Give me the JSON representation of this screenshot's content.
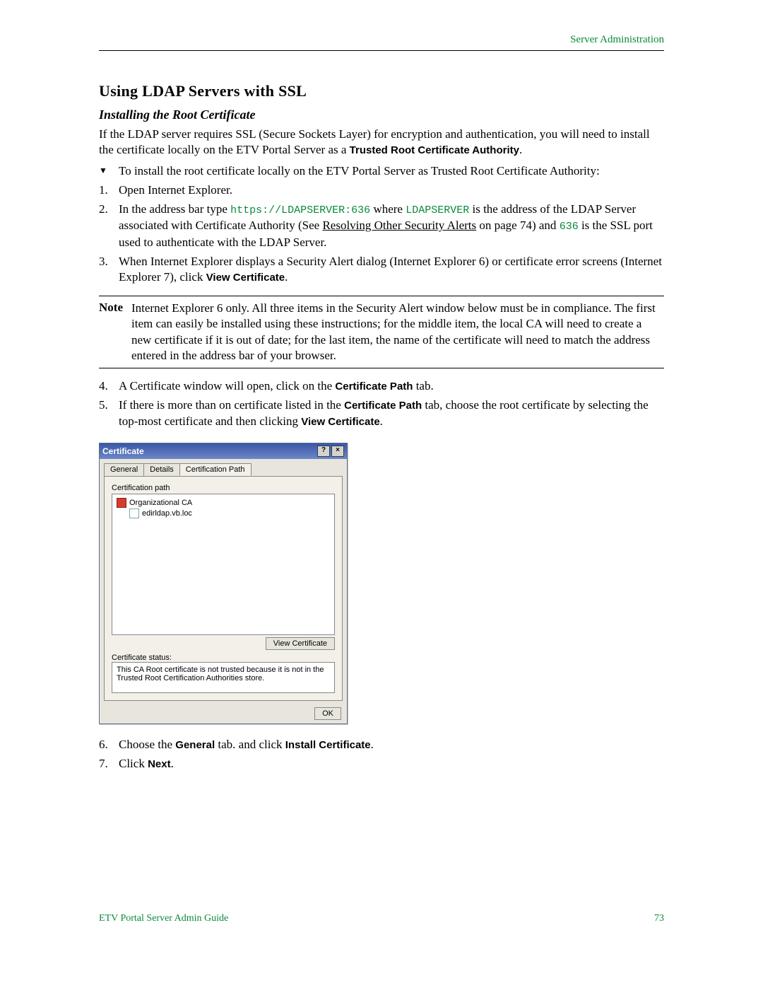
{
  "header": {
    "right": "Server Administration"
  },
  "section": {
    "title": "Using LDAP Servers with SSL"
  },
  "subsection": {
    "title": "Installing the Root Certificate"
  },
  "intro": {
    "p1a": "If the LDAP server requires SSL (Secure Sockets Layer) for encryption and authentication, you will need to install the certificate locally on the ETV Portal Server as a ",
    "p1b": "Trusted Root Certificate Authority",
    "p1c": "."
  },
  "steps_a": {
    "lead_marker": "▼",
    "lead": "To install the root certificate locally on the ETV Portal Server as Trusted Root Certificate Authority:",
    "s1_marker": "1.",
    "s1": "Open Internet Explorer.",
    "s2_marker": "2.",
    "s2a": "In the address bar type ",
    "s2_code1": "https://LDAPSERVER:636",
    "s2b": " where ",
    "s2_code2": "LDAPSERVER",
    "s2c": " is the address of the LDAP Server associated with Certificate Authority (See ",
    "s2_link": "Resolving Other Security Alerts",
    "s2d": " on page 74) and ",
    "s2_code3": "636",
    "s2e": " is the SSL port used to authenticate with the LDAP Server.",
    "s3_marker": "3.",
    "s3a": "When Internet Explorer displays a Security Alert dialog (Internet Explorer 6) or certificate error screens (Internet Explorer 7), click ",
    "s3_bold": "View Certificate",
    "s3b": "."
  },
  "note": {
    "label": "Note",
    "body": "Internet Explorer 6 only. All three items in the Security Alert window below must be in compliance. The first item can easily be installed using these instructions; for the middle item, the local CA will need to create a new certificate if it is out of date; for the last item, the name of the certificate will need to match the address entered in the address bar of your browser."
  },
  "steps_b": {
    "s4_marker": "4.",
    "s4a": "A Certificate window will open, click on the ",
    "s4_bold": "Certificate Path",
    "s4b": " tab.",
    "s5_marker": "5.",
    "s5a": "If there is more than on certificate listed in the ",
    "s5_bold1": "Certificate Path",
    "s5b": " tab, choose the root certificate by selecting the top-most certificate and then clicking ",
    "s5_bold2": "View Certificate",
    "s5c": "."
  },
  "dialog": {
    "title": "Certificate",
    "help": "?",
    "close": "×",
    "tabs": {
      "general": "General",
      "details": "Details",
      "certpath": "Certification Path"
    },
    "group_label": "Certification path",
    "tree": {
      "root": "Organizational CA",
      "child": "edirldap.vb.loc"
    },
    "view_cert_btn": "View Certificate",
    "status_label": "Certificate status:",
    "status_text": "This CA Root certificate is not trusted because it is not in the Trusted Root Certification Authorities store.",
    "ok_btn": "OK"
  },
  "steps_c": {
    "s6_marker": "6.",
    "s6a": "Choose the ",
    "s6_bold1": "General",
    "s6b": " tab. and click ",
    "s6_bold2": "Install Certificate",
    "s6c": ".",
    "s7_marker": "7.",
    "s7a": "Click ",
    "s7_bold": "Next",
    "s7b": "."
  },
  "footer": {
    "left": "ETV Portal Server Admin Guide",
    "right": "73"
  }
}
